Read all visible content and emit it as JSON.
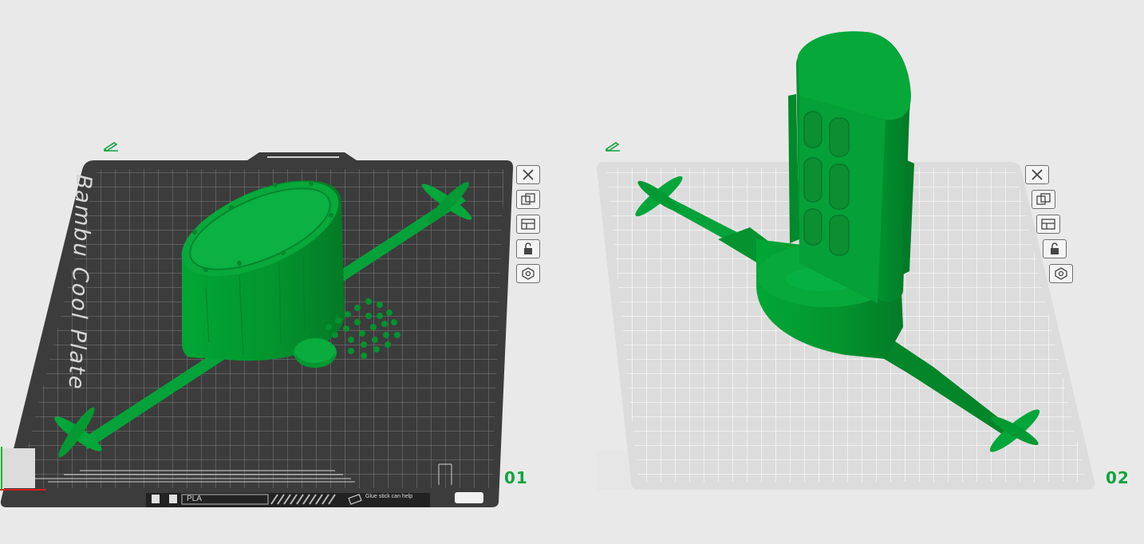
{
  "plates": [
    {
      "number": "01",
      "bed_label": "Bambu Cool Plate",
      "filament": "PLA",
      "glue_line1": "Glue stick can help",
      "glue_line2": "...",
      "qr_label": "?"
    },
    {
      "number": "02"
    }
  ],
  "toolbar_icons": [
    "close-icon",
    "auto-arrange-icon",
    "orient-icon",
    "lock-icon",
    "settings-icon"
  ],
  "colors": {
    "model_green": "#00a033",
    "dark_bed": "#3c3c3c",
    "light_bed": "#dcdcdc",
    "plate_number": "#10a33f"
  }
}
